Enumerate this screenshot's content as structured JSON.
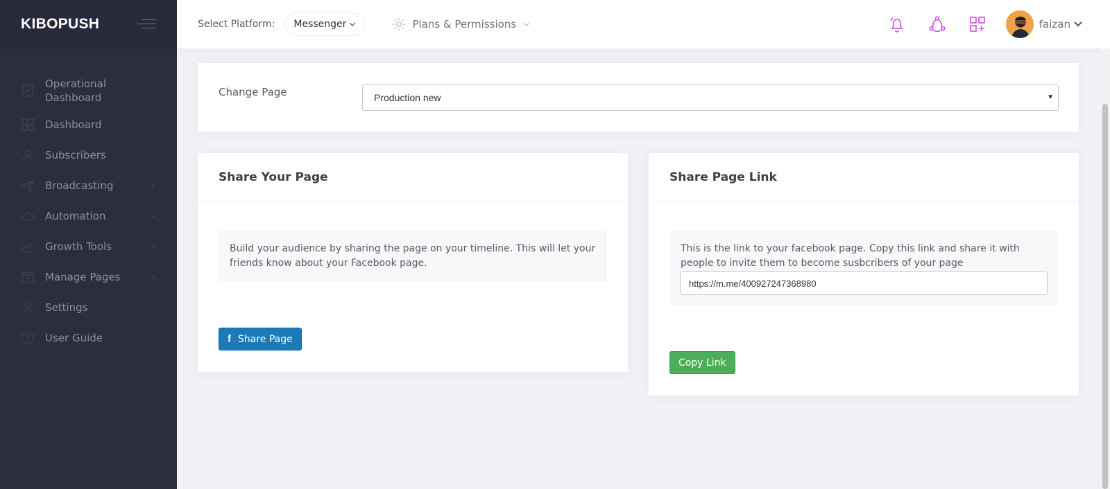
{
  "brand": {
    "name": "KIBOPUSH"
  },
  "sidebar": {
    "items": [
      {
        "label": "Operational Dashboard",
        "icon": "chart-doc-icon",
        "has_arrow": false
      },
      {
        "label": "Dashboard",
        "icon": "grid-icon",
        "has_arrow": false
      },
      {
        "label": "Subscribers",
        "icon": "user-icon",
        "has_arrow": false
      },
      {
        "label": "Broadcasting",
        "icon": "paper-plane-icon",
        "has_arrow": true
      },
      {
        "label": "Automation",
        "icon": "cloud-icon",
        "has_arrow": true
      },
      {
        "label": "Growth Tools",
        "icon": "line-chart-icon",
        "has_arrow": true
      },
      {
        "label": "Manage Pages",
        "icon": "add-page-icon",
        "has_arrow": true
      },
      {
        "label": "Settings",
        "icon": "gear-icon",
        "has_arrow": false
      },
      {
        "label": "User Guide",
        "icon": "question-icon",
        "has_arrow": false
      }
    ],
    "arrow_glyph": "›"
  },
  "topbar": {
    "platform_label": "Select Platform:",
    "platform_value": "Messenger",
    "plans_label": "Plans & Permissions",
    "user_name": "faizan",
    "icons": [
      "notification-bell-icon",
      "share-network-icon",
      "apps-grid-icon"
    ]
  },
  "change_page": {
    "label": "Change Page",
    "selected": "Production new"
  },
  "share_page": {
    "title": "Share Your Page",
    "note": "Build your audience by sharing the page on your timeline. This will let your friends know about your Facebook page.",
    "button_label": "Share Page",
    "button_icon_glyph": "f"
  },
  "share_link": {
    "title": "Share Page Link",
    "note": "This is the link to your facebook page. Copy this link and share it with people to invite them to become susbcribers of your page",
    "link_value": "https://m.me/400927247368980",
    "button_label": "Copy Link"
  },
  "colors": {
    "sidebar_bg": "#2c2e3e",
    "brand_bg": "#282a3c",
    "accent_purple": "#c84fe0",
    "facebook_blue": "#1d7ab8",
    "copy_green": "#4cae5b"
  }
}
